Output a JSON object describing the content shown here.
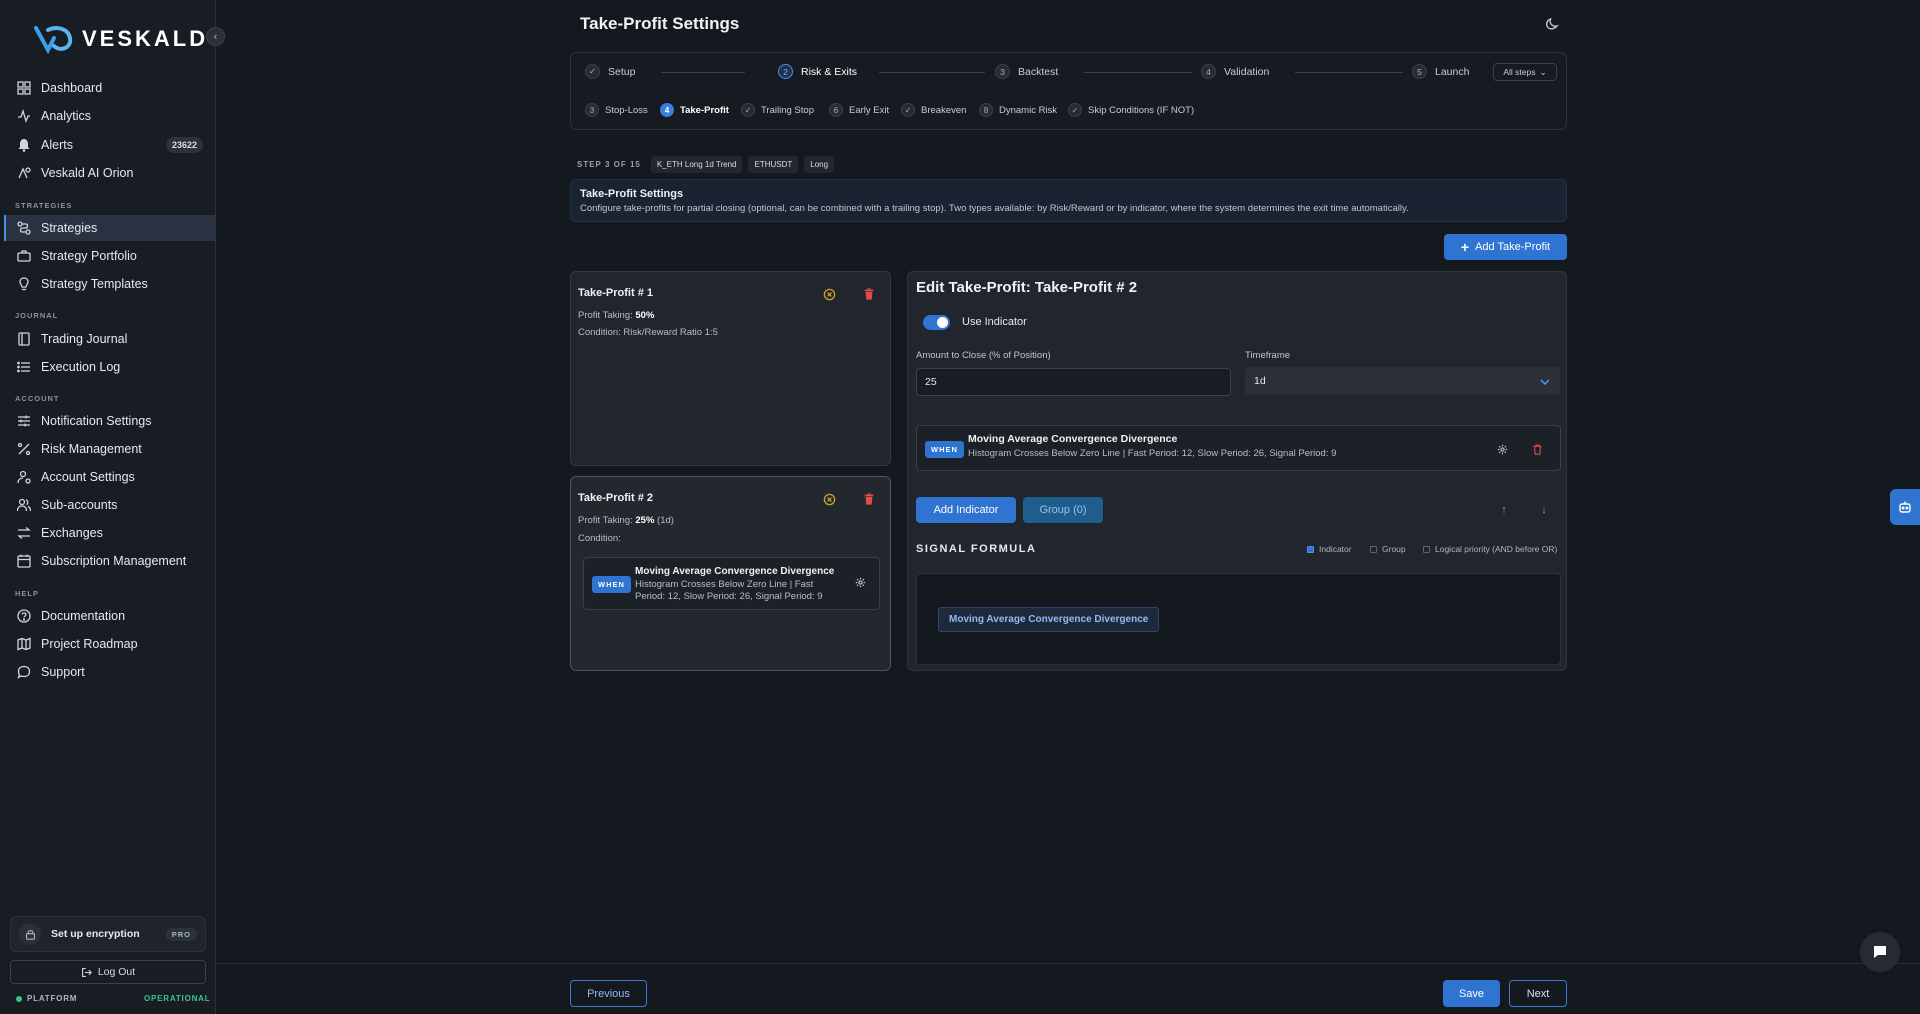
{
  "brand": {
    "name": "VESKALD"
  },
  "sidebar": {
    "items": [
      {
        "label": "Dashboard",
        "icon": "grid-icon"
      },
      {
        "label": "Analytics",
        "icon": "activity-icon"
      },
      {
        "label": "Alerts",
        "icon": "bell-icon",
        "badge": "23622"
      },
      {
        "label": "Veskald AI Orion",
        "icon": "ai-icon"
      }
    ],
    "sections": {
      "strategies": "STRATEGIES",
      "journal": "JOURNAL",
      "account": "ACCOUNT",
      "help": "HELP"
    },
    "strategy_items": [
      {
        "label": "Strategies",
        "icon": "route-icon",
        "active": true
      },
      {
        "label": "Strategy Portfolio",
        "icon": "briefcase-icon"
      },
      {
        "label": "Strategy Templates",
        "icon": "lightbulb-icon"
      }
    ],
    "journal_items": [
      {
        "label": "Trading Journal",
        "icon": "book-icon"
      },
      {
        "label": "Execution Log",
        "icon": "list-icon"
      }
    ],
    "account_items": [
      {
        "label": "Notification Settings",
        "icon": "sliders-icon"
      },
      {
        "label": "Risk Management",
        "icon": "percent-icon"
      },
      {
        "label": "Account Settings",
        "icon": "user-gear-icon"
      },
      {
        "label": "Sub-accounts",
        "icon": "users-icon"
      },
      {
        "label": "Exchanges",
        "icon": "swap-icon"
      },
      {
        "label": "Subscription Management",
        "icon": "calendar-icon"
      }
    ],
    "help_items": [
      {
        "label": "Documentation",
        "icon": "help-circle-icon"
      },
      {
        "label": "Project Roadmap",
        "icon": "map-icon"
      },
      {
        "label": "Support",
        "icon": "chat-icon"
      }
    ],
    "encryption": {
      "label": "Set up encryption",
      "badge": "PRO"
    },
    "logout": "Log Out",
    "platform": {
      "label": "PLATFORM",
      "status": "OPERATIONAL"
    }
  },
  "header": {
    "title": "Take-Profit Settings"
  },
  "stepper": {
    "steps": [
      {
        "num": "✓",
        "label": "Setup"
      },
      {
        "num": "2",
        "label": "Risk & Exits"
      },
      {
        "num": "3",
        "label": "Backtest"
      },
      {
        "num": "4",
        "label": "Validation"
      },
      {
        "num": "5",
        "label": "Launch"
      }
    ],
    "all_steps": "All steps",
    "substeps": [
      {
        "num": "3",
        "label": "Stop-Loss"
      },
      {
        "num": "4",
        "label": "Take-Profit"
      },
      {
        "num": "✓",
        "label": "Trailing Stop"
      },
      {
        "num": "6",
        "label": "Early Exit"
      },
      {
        "num": "✓",
        "label": "Breakeven"
      },
      {
        "num": "8",
        "label": "Dynamic Risk"
      },
      {
        "num": "✓",
        "label": "Skip Conditions (IF NOT)"
      }
    ]
  },
  "step_info": {
    "label": "STEP 3 OF 15",
    "chips": [
      "K_ETH Long 1d Trend",
      "ETHUSDT",
      "Long"
    ]
  },
  "info": {
    "title": "Take-Profit Settings",
    "text": "Configure take-profits for partial closing (optional, can be combined with a trailing stop). Two types available: by Risk/Reward or by indicator, where the system determines the exit time automatically."
  },
  "add_tp_label": "Add Take-Profit",
  "tp_cards": [
    {
      "title": "Take-Profit # 1",
      "taking_label": "Profit Taking:",
      "taking_value": "50%",
      "condition": "Condition: Risk/Reward Ratio 1:5"
    },
    {
      "title": "Take-Profit # 2",
      "taking_label": "Profit Taking:",
      "taking_value": "25%",
      "taking_suffix": "(1d)",
      "condition": "Condition:",
      "indicator": {
        "when": "WHEN",
        "name": "Moving Average Convergence Divergence",
        "desc": "Histogram Crosses Below Zero Line | Fast Period: 12, Slow Period: 26, Signal Period: 9"
      }
    }
  ],
  "edit": {
    "title": "Edit Take-Profit: Take-Profit # 2",
    "toggle_label": "Use Indicator",
    "amount_label": "Amount to Close (% of Position)",
    "amount_value": "25",
    "timeframe_label": "Timeframe",
    "timeframe_value": "1d",
    "indicator": {
      "when": "WHEN",
      "name": "Moving Average Convergence Divergence",
      "desc": "Histogram Crosses Below Zero Line | Fast Period: 12, Slow Period: 26, Signal Period: 9"
    },
    "add_indicator": "Add Indicator",
    "group": "Group (0)",
    "signal_title": "SIGNAL FORMULA",
    "legend": [
      "Indicator",
      "Group",
      "Logical priority (AND before OR)"
    ],
    "formula_chip": "Moving Average Convergence Divergence"
  },
  "footer": {
    "previous": "Previous",
    "save": "Save",
    "next": "Next"
  }
}
